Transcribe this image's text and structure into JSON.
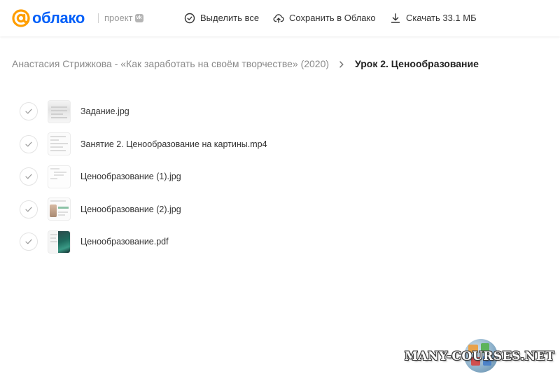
{
  "header": {
    "logo_text": "облако",
    "project_label": "проект",
    "vk_badge": "vk",
    "select_all_label": "Выделить все",
    "save_label": "Сохранить в Облако",
    "download_label": "Скачать 33.1 МБ"
  },
  "breadcrumb": {
    "parent": "Анастасия Стрижкова - «Как заработать на своём творчестве» (2020)",
    "current": "Урок 2. Ценообразование"
  },
  "files": [
    {
      "name": "Задание.jpg",
      "selected": false
    },
    {
      "name": "Занятие 2. Ценообразование на картины.mp4",
      "selected": false
    },
    {
      "name": "Ценообразование (1).jpg",
      "selected": false
    },
    {
      "name": "Ценообразование (2).jpg",
      "selected": false
    },
    {
      "name": "Ценообразование.pdf",
      "selected": false
    }
  ],
  "watermark": "MANY-COURSES.NET",
  "colors": {
    "brand": "#005ff9",
    "text": "#333333",
    "muted": "#8a8a8a"
  },
  "icons": {
    "logo": "at-sign-logo-icon",
    "select_all": "check-circle-icon",
    "save": "cloud-upload-icon",
    "download": "download-arrow-icon",
    "breadcrumb_separator": "chevron-right-icon",
    "row_select": "checkmark-icon"
  }
}
